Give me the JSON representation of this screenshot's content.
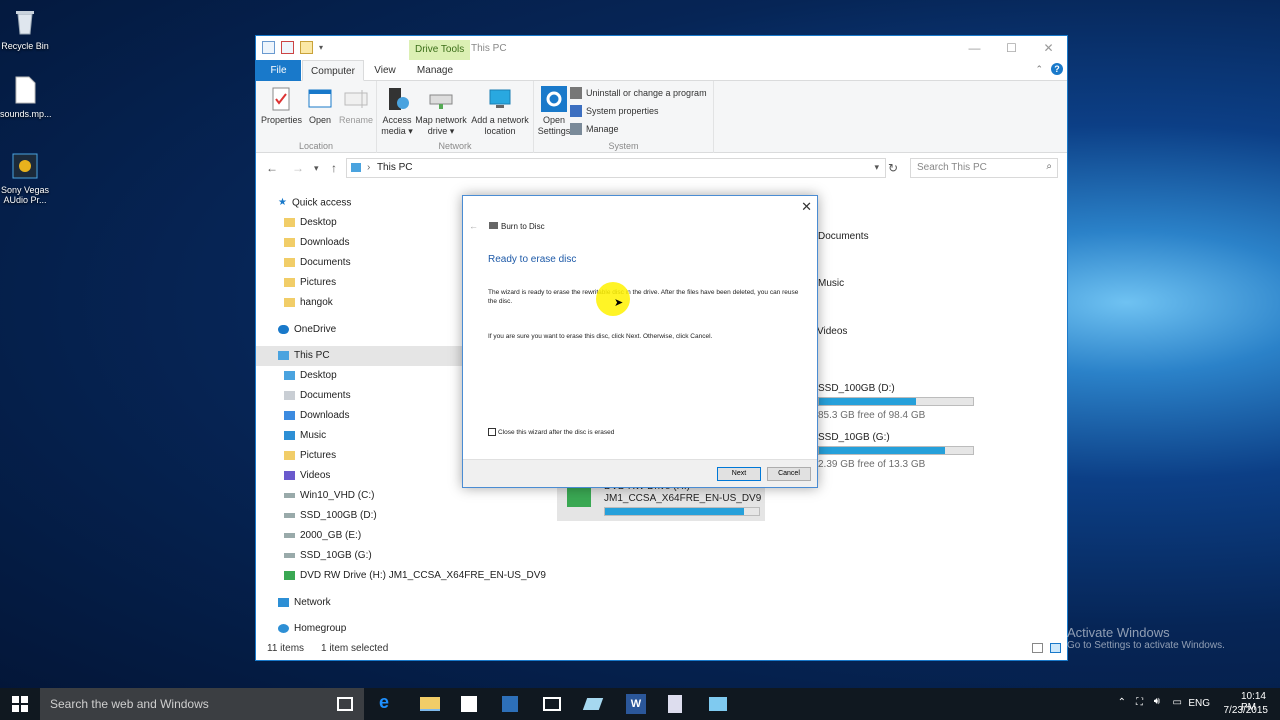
{
  "desktop": {
    "icons": [
      {
        "label": "Recycle Bin",
        "icon": "recycle-bin-icon"
      },
      {
        "label": "sounds.mp...",
        "icon": "file-icon"
      },
      {
        "label": "Sony Vegas AUdio Pr...",
        "icon": "app-icon"
      }
    ],
    "watermark_title": "Activate Windows",
    "watermark_sub": "Go to Settings to activate Windows."
  },
  "window": {
    "contextual_tab": "Drive Tools",
    "title": "This PC",
    "tabs": [
      "File",
      "Computer",
      "View",
      "Manage"
    ],
    "ribbon": {
      "location": {
        "label": "Location",
        "buttons": [
          "Properties",
          "Open",
          "Rename"
        ]
      },
      "network": {
        "label": "Network",
        "buttons": [
          "Access media",
          "Map network drive",
          "Add a network location"
        ]
      },
      "system": {
        "label": "System",
        "open_settings": "Open Settings",
        "items": [
          "Uninstall or change a program",
          "System properties",
          "Manage"
        ]
      }
    },
    "address": "This PC",
    "search_placeholder": "Search This PC",
    "nav": [
      {
        "label": "Quick access",
        "icon": "star-icon",
        "indent": 0
      },
      {
        "label": "Desktop",
        "icon": "folder-icon",
        "indent": 1
      },
      {
        "label": "Downloads",
        "icon": "folder-icon",
        "indent": 1
      },
      {
        "label": "Documents",
        "icon": "folder-icon",
        "indent": 1
      },
      {
        "label": "Pictures",
        "icon": "folder-icon",
        "indent": 1
      },
      {
        "label": "hangok",
        "icon": "folder-icon",
        "indent": 1
      },
      {
        "label": "OneDrive",
        "icon": "cloud-icon",
        "indent": 0
      },
      {
        "label": "This PC",
        "icon": "computer-icon",
        "indent": 0,
        "selected": true
      },
      {
        "label": "Desktop",
        "icon": "folder-icon",
        "indent": 1
      },
      {
        "label": "Documents",
        "icon": "folder-icon",
        "indent": 1
      },
      {
        "label": "Downloads",
        "icon": "folder-icon",
        "indent": 1
      },
      {
        "label": "Music",
        "icon": "music-icon",
        "indent": 1
      },
      {
        "label": "Pictures",
        "icon": "folder-icon",
        "indent": 1
      },
      {
        "label": "Videos",
        "icon": "video-icon",
        "indent": 1
      },
      {
        "label": "Win10_VHD (C:)",
        "icon": "drive-icon",
        "indent": 1
      },
      {
        "label": "SSD_100GB (D:)",
        "icon": "drive-icon",
        "indent": 1
      },
      {
        "label": "2000_GB (E:)",
        "icon": "drive-icon",
        "indent": 1
      },
      {
        "label": "SSD_10GB (G:)",
        "icon": "drive-icon",
        "indent": 1
      },
      {
        "label": "DVD RW Drive (H:) JM1_CCSA_X64FRE_EN-US_DV9",
        "icon": "dvd-icon",
        "indent": 1
      },
      {
        "label": "Network",
        "icon": "network-icon",
        "indent": 0
      },
      {
        "label": "Homegroup",
        "icon": "homegroup-icon",
        "indent": 0
      }
    ],
    "content": {
      "folders": [
        "Documents",
        "Music",
        "Videos"
      ],
      "drives": [
        {
          "name": "SSD_100GB (D:)",
          "free": "85.3 GB free of 98.4 GB",
          "used_fraction": 0.13
        },
        {
          "name": "SSD_10GB (G:)",
          "free": "2.39 GB free of 13.3 GB",
          "used_fraction": 0.82
        }
      ],
      "dvd": {
        "line1": "DVD RW Drive (H:)",
        "line2": "JM1_CCSA_X64FRE_EN-US_DV9",
        "used_fraction": 0.9
      }
    },
    "status": {
      "items": "11 items",
      "selected": "1 item selected"
    }
  },
  "dialog": {
    "title": "Burn to Disc",
    "heading": "Ready to erase disc",
    "para1": "The wizard is ready to erase the rewritable disc in the drive. After the files have been deleted, you can reuse the disc.",
    "para2": "If you are sure you want to erase this disc, click Next. Otherwise, click Cancel.",
    "checkbox_label": "Close this wizard after the disc is erased",
    "checkbox_checked": false,
    "next": "Next",
    "cancel": "Cancel"
  },
  "taskbar": {
    "search": "Search the web and Windows",
    "lang": "ENG",
    "time": "10:14 PM",
    "date": "7/23/2015"
  }
}
